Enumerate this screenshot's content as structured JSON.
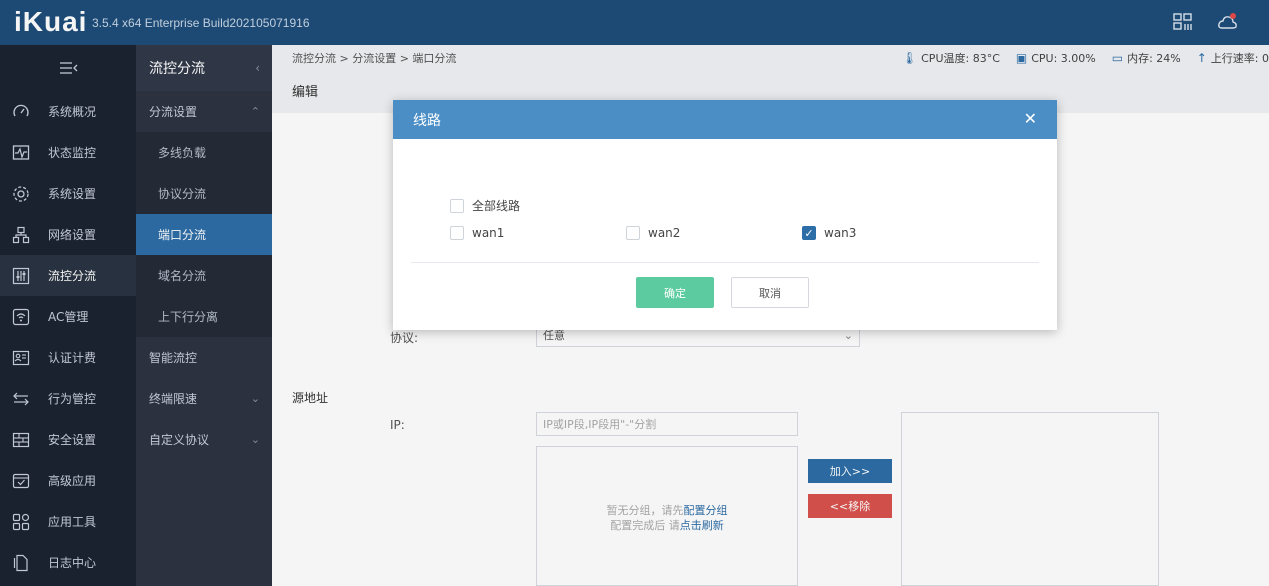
{
  "app": {
    "logo": "iKuai",
    "version": "3.5.4 x64 Enterprise Build202105071916"
  },
  "topbar_icons": [
    "grid-icon",
    "cloud-icon"
  ],
  "sidebar": {
    "toggle_icon": "menu-collapse-icon",
    "items": [
      {
        "label": "系统概况",
        "icon": "dashboard-icon"
      },
      {
        "label": "状态监控",
        "icon": "monitor-icon"
      },
      {
        "label": "系统设置",
        "icon": "gear-icon"
      },
      {
        "label": "网络设置",
        "icon": "network-icon"
      },
      {
        "label": "流控分流",
        "icon": "sliders-icon"
      },
      {
        "label": "AC管理",
        "icon": "wifi-icon"
      },
      {
        "label": "认证计费",
        "icon": "id-card-icon"
      },
      {
        "label": "行为管控",
        "icon": "arrows-icon"
      },
      {
        "label": "安全设置",
        "icon": "firewall-icon"
      },
      {
        "label": "高级应用",
        "icon": "check-box-icon"
      },
      {
        "label": "应用工具",
        "icon": "tools-icon"
      },
      {
        "label": "日志中心",
        "icon": "log-icon"
      }
    ],
    "active_index": 4
  },
  "subbar": {
    "title": "流控分流",
    "groups": [
      {
        "label": "分流设置",
        "expanded": true,
        "items": [
          "多线负载",
          "协议分流",
          "端口分流",
          "域名分流",
          "上下行分离"
        ],
        "active": "端口分流"
      },
      {
        "label": "智能流控"
      },
      {
        "label": "终端限速",
        "expandable": true
      },
      {
        "label": "自定义协议",
        "expandable": true
      }
    ]
  },
  "breadcrumb": "流控分流 > 分流设置 > 端口分流",
  "stats": {
    "cpu_temp": "CPU温度: 83°C",
    "cpu": "CPU: 3.00%",
    "memory": "内存: 24%",
    "upload": "上行速率: 0"
  },
  "edit_title": "编辑",
  "form": {
    "protocol_label": "协议:",
    "protocol_value": "任意",
    "source_section": "源地址",
    "ip_label": "IP:",
    "ip_placeholder": "IP或IP段,IP段用\"-\"分割",
    "empty_line1_prefix": "暂无分组，请先",
    "empty_line1_link": "配置分组",
    "empty_line2_prefix": "配置完成后 请",
    "empty_line2_link": "点击刷新",
    "add_button": "加入>>",
    "remove_button": "<<移除"
  },
  "modal": {
    "title": "线路",
    "all_lines_label": "全部线路",
    "all_lines_checked": false,
    "lines": [
      {
        "label": "wan1",
        "checked": false
      },
      {
        "label": "wan2",
        "checked": false
      },
      {
        "label": "wan3",
        "checked": true
      }
    ],
    "ok_label": "确定",
    "cancel_label": "取消"
  },
  "colors": {
    "topbar": "#1e4e7a",
    "sidebar": "#1c2431",
    "active_sub": "#2e6ea8",
    "modal_header": "#4b8ec6",
    "ok_button": "#5ccca0"
  }
}
